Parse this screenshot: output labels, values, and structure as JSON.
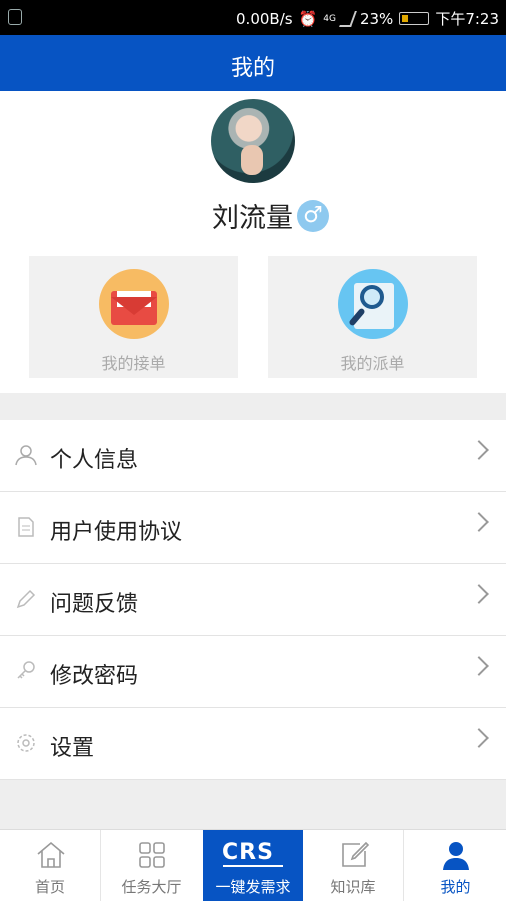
{
  "status_bar": {
    "speed": "0.00B/s",
    "network": "4G",
    "battery": "23%",
    "battery_level": 23,
    "time": "下午7:23"
  },
  "header": {
    "title": "我的"
  },
  "profile": {
    "name": "刘流量",
    "gender_symbol": "♂",
    "cards": [
      {
        "label": "我的接单",
        "icon": "envelope-icon"
      },
      {
        "label": "我的派单",
        "icon": "magnifier-document-icon"
      }
    ]
  },
  "menu": {
    "items": [
      {
        "label": "个人信息",
        "icon": "person-icon"
      },
      {
        "label": "用户使用协议",
        "icon": "document-icon"
      },
      {
        "label": "问题反馈",
        "icon": "pencil-icon"
      },
      {
        "label": "修改密码",
        "icon": "key-icon"
      },
      {
        "label": "设置",
        "icon": "gear-icon"
      }
    ]
  },
  "tabbar": {
    "tabs": [
      {
        "label": "首页",
        "icon": "home-icon"
      },
      {
        "label": "任务大厅",
        "icon": "grid-icon"
      },
      {
        "label": "一键发需求",
        "logo": "CRS"
      },
      {
        "label": "知识库",
        "icon": "edit-square-icon"
      },
      {
        "label": "我的",
        "icon": "person-filled-icon"
      }
    ],
    "active_color": "#0754c3",
    "inactive_color": "#777777"
  },
  "colors": {
    "brand": "#0754c3",
    "background": "#eeeeee"
  }
}
